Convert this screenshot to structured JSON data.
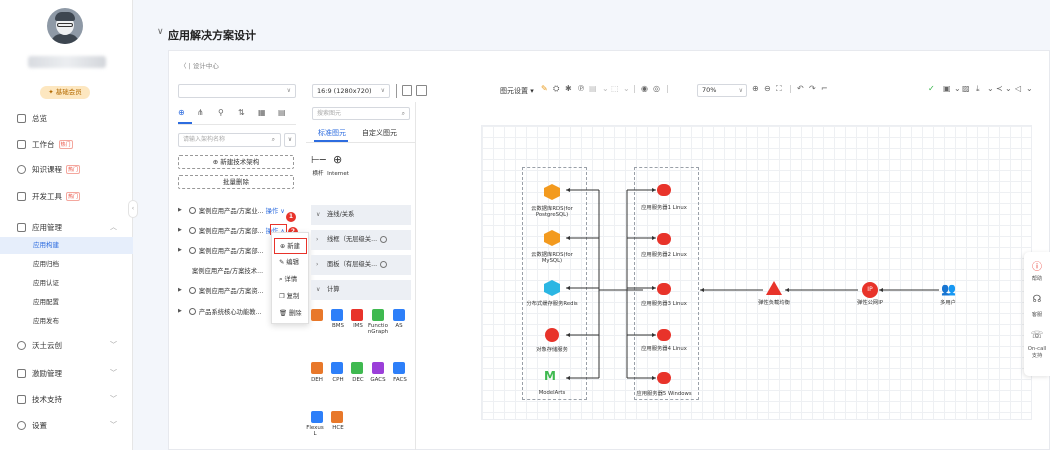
{
  "sidebar": {
    "badge": "基础会员",
    "nav": [
      {
        "label": "总览"
      },
      {
        "label": "工作台",
        "hot": "热门"
      },
      {
        "label": "知识课程",
        "hot": "热门"
      },
      {
        "label": "开发工具",
        "hot": "热门"
      },
      {
        "label": "应用管理"
      }
    ],
    "sub": [
      "应用构建",
      "应用归档",
      "应用认证",
      "应用配置",
      "应用发布"
    ],
    "nav2": [
      "沃土云创",
      "激励管理",
      "技术支持",
      "设置"
    ]
  },
  "header": {
    "title": "应用解决方案设计",
    "breadcrumb": "〈 | 设计中心"
  },
  "toolbar": {
    "canvas_size": "16:9 (1280x720)",
    "canvas_settings": "图元设置 ▾",
    "zoom": "70%"
  },
  "tree": {
    "search_placeholder": "请输入架构名称",
    "new_arch": "⊕ 新建技术架构",
    "batch_delete": "批量删除",
    "rows": [
      {
        "text": "案例应用产品/方案业...",
        "op": "操作 ∨"
      },
      {
        "text": "案例应用产品/方案部...",
        "op": "操作 ∧"
      },
      {
        "text": "案例应用产品/方案部...",
        "op": ""
      },
      {
        "text": "案例应用产品/方案技术...",
        "op": ""
      },
      {
        "text": "案例应用产品/方案资...",
        "op": ""
      },
      {
        "text": "产品系统核心功能教...",
        "op": ""
      }
    ],
    "badge1": "1",
    "badge2": "2"
  },
  "context_menu": [
    "⊕ 新建",
    "✎ 编辑",
    "⌕ 详情",
    "❐ 复制",
    "🗑 删除"
  ],
  "elements": {
    "search_placeholder": "搜索图元",
    "tab_standard": "标准图元",
    "tab_custom": "自定义图元",
    "basic": [
      "横杆",
      "Internet"
    ],
    "sections": [
      "连线/关系",
      "线框（无层级关...",
      "面板（有层级关...",
      "计算"
    ],
    "compute": [
      "BMS",
      "IMS",
      "FunctionGraph",
      "AS",
      "DEH",
      "CPH",
      "DEC",
      "GACS",
      "FACS",
      "Flexus L",
      "HCE"
    ]
  },
  "diagram": {
    "db_nodes": [
      "云数据库RDS(for PostgreSQL)",
      "云数据库RDS(for MySQL)",
      "分布式缓存服务Redis",
      "对象存储服务",
      "ModelArts"
    ],
    "servers": [
      "应用服务器1 Linux",
      "应用服务器2 Linux",
      "应用服务器3 Linux",
      "应用服务器4 Linux",
      "应用服务器5 Windows"
    ],
    "elb": "弹性负载均衡",
    "eip": "弹性公网IP",
    "eip_icon_text": "IP",
    "users": "多用户"
  },
  "right_float": [
    "帮助",
    "客服",
    "On-call 支持"
  ],
  "colors": {
    "accent": "#2d6cdf",
    "highlight": "#e8332a",
    "db": "#f39a1e",
    "server": "#e8332a",
    "redis": "#2bb6e3",
    "modelarts": "#3fb950"
  }
}
